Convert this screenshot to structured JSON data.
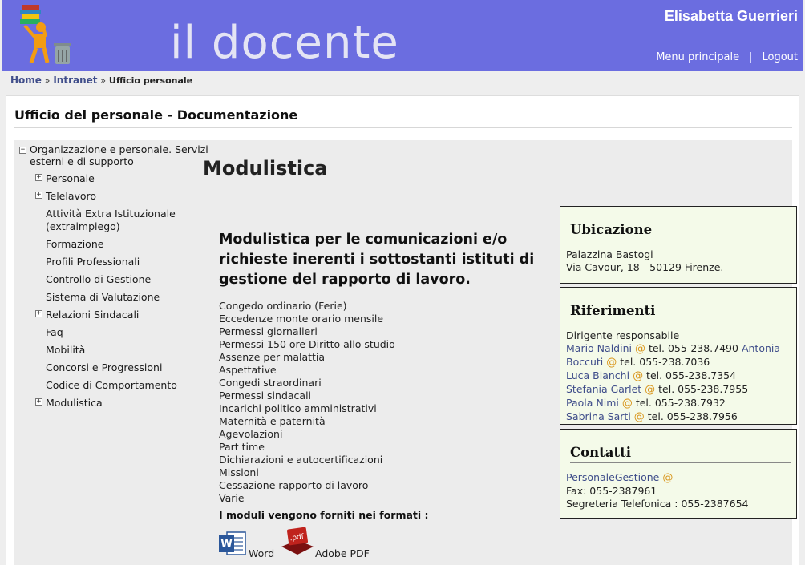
{
  "header": {
    "brand": "il docente",
    "user_name": "Elisabetta Guerrieri",
    "menu_link": "Menu principale",
    "separator": "|",
    "logout_link": "Logout",
    "logo_icon": "books-trash-person-icon",
    "color": "#6b6de0"
  },
  "breadcrumb": {
    "home": "Home",
    "sep1": "»",
    "intranet": "Intranet",
    "sep2": "»",
    "current": "Ufficio personale"
  },
  "page_title": "Ufficio del personale - Documentazione",
  "sidebar": {
    "root_label": "Organizzazione e personale. Servizi esterni e di supporto",
    "root_toggle": "−",
    "items": [
      {
        "label": "Personale",
        "toggle": "+"
      },
      {
        "label": "Telelavoro",
        "toggle": "+"
      },
      {
        "label": "Attività Extra Istituzionale (extraimpiego)",
        "toggle": ""
      },
      {
        "label": "Formazione",
        "toggle": ""
      },
      {
        "label": "Profili Professionali",
        "toggle": ""
      },
      {
        "label": "Controllo di Gestione",
        "toggle": ""
      },
      {
        "label": "Sistema di Valutazione",
        "toggle": ""
      },
      {
        "label": "Relazioni Sindacali",
        "toggle": "+"
      },
      {
        "label": "Faq",
        "toggle": ""
      },
      {
        "label": "Mobilità",
        "toggle": ""
      },
      {
        "label": "Concorsi e Progressioni",
        "toggle": ""
      },
      {
        "label": "Codice di Comportamento",
        "toggle": ""
      },
      {
        "label": "Modulistica",
        "toggle": "+"
      }
    ]
  },
  "main": {
    "title": "Modulistica",
    "intro": "Modulistica per le comunicazioni e/o richieste inerenti i sottostanti istituti di gestione del rapporto di lavoro.",
    "forms": [
      "Congedo ordinario (Ferie)",
      "Eccedenze monte orario mensile",
      "Permessi giornalieri",
      "Permessi 150 ore Diritto allo studio",
      "Assenze per malattia",
      "Aspettative",
      "Congedi straordinari",
      "Permessi sindacali",
      "Incarichi politico amministrativi",
      "Maternità e paternità",
      "Agevolazioni",
      "Part time",
      "Dichiarazioni e autocertificazioni",
      "Missioni",
      "Cessazione rapporto di lavoro",
      "Varie"
    ],
    "formats_title": "I moduli vengono forniti nei formati :",
    "format_word": "Word",
    "format_pdf": "Adobe PDF",
    "pdf_icon_text": ".pdf",
    "word_icon_text": "W"
  },
  "ubicazione": {
    "title": "Ubicazione",
    "line1": "Palazzina Bastogi",
    "line2": "Via Cavour, 18 - 50129 Firenze."
  },
  "riferimenti": {
    "title": "Riferimenti",
    "intro": "Dirigente responsabile",
    "at": "@",
    "people": [
      {
        "name": "Mario Naldini",
        "tel": "tel. 055-238.7490"
      },
      {
        "name": "Antonia Boccuti",
        "tel": "tel. 055-238.7036"
      },
      {
        "name": "Luca Bianchi",
        "tel": "tel. 055-238.7354"
      },
      {
        "name": "Stefania Garlet",
        "tel": "tel. 055-238.7955"
      },
      {
        "name": "Paola Nimi",
        "tel": "tel. 055-238.7932"
      },
      {
        "name": "Sabrina Sarti",
        "tel": "tel. 055-238.7956"
      }
    ]
  },
  "contatti": {
    "title": "Contatti",
    "email_name": "PersonaleGestione",
    "at": "@",
    "fax": "Fax: 055-2387961",
    "segreteria": "Segreteria Telefonica : 055-2387654"
  }
}
